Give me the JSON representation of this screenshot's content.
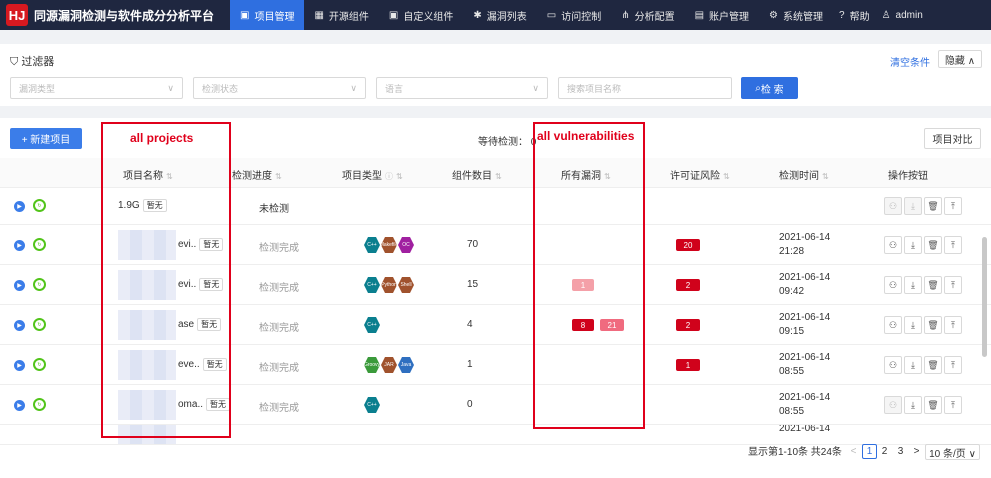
{
  "nav": {
    "logo": "HJ",
    "title": "同源漏洞检测与软件成分分析平台",
    "items": [
      {
        "label": "项目管理",
        "icon": "▣"
      },
      {
        "label": "开源组件",
        "icon": "▦"
      },
      {
        "label": "自定义组件",
        "icon": "▣"
      },
      {
        "label": "漏洞列表",
        "icon": "✱"
      },
      {
        "label": "访问控制",
        "icon": "▭"
      },
      {
        "label": "分析配置",
        "icon": "⋔"
      },
      {
        "label": "账户管理",
        "icon": "▤"
      },
      {
        "label": "系统管理",
        "icon": "⚙"
      },
      {
        "label": "帮助",
        "icon": "?"
      },
      {
        "label": "admin",
        "icon": "♙"
      }
    ]
  },
  "filter": {
    "title": "过滤器",
    "clear": "清空条件",
    "hide": "隐藏 ∧",
    "vuln_type_placeholder": "漏洞类型",
    "status_placeholder": "检测状态",
    "language_placeholder": "语言",
    "search_placeholder": "搜索项目名称",
    "search_button": "检 索"
  },
  "toolbar": {
    "new_project": "+ 新建项目",
    "pending": "等待检测： 0",
    "compare": "项目对比"
  },
  "columns": [
    "项目名称",
    "检测进度",
    "项目类型",
    "组件数目",
    "所有漏洞",
    "许可证风险",
    "检测时间",
    "操作按钮"
  ],
  "rows": [
    {
      "name": "1.9G",
      "tag": "暂无",
      "status": "未检测",
      "types": [],
      "count": "",
      "vulns": [],
      "license": "",
      "date": "",
      "time": ""
    },
    {
      "name": "evi..",
      "tag": "暂无",
      "status": "检测完成",
      "types": [
        {
          "label": "C++",
          "color": "#0b7f8f"
        },
        {
          "label": "Makefile",
          "color": "#a0522d"
        },
        {
          "label": "OC",
          "color": "#a020a0"
        }
      ],
      "count": "70",
      "vulns": [],
      "license": "20",
      "date": "2021-06-14",
      "time": "21:28"
    },
    {
      "name": "evi..",
      "tag": "暂无",
      "status": "检测完成",
      "types": [
        {
          "label": "C++",
          "color": "#0b7f8f"
        },
        {
          "label": "Python",
          "color": "#a0522d"
        },
        {
          "label": "Shell",
          "color": "#a0522d"
        }
      ],
      "count": "15",
      "vulns": [
        {
          "value": "1",
          "color": "#f4a0a8"
        }
      ],
      "license": "2",
      "date": "2021-06-14",
      "time": "09:42"
    },
    {
      "name": "ase",
      "tag": "暂无",
      "status": "检测完成",
      "types": [
        {
          "label": "C++",
          "color": "#0b7f8f"
        }
      ],
      "count": "4",
      "vulns": [
        {
          "value": "8",
          "color": "#d0021b"
        },
        {
          "value": "21",
          "color": "#f06b7f"
        }
      ],
      "license": "2",
      "date": "2021-06-14",
      "time": "09:15"
    },
    {
      "name": "eve..",
      "tag": "暂无",
      "status": "检测完成",
      "types": [
        {
          "label": "Groovy",
          "color": "#3a9a3a"
        },
        {
          "label": "JAR",
          "color": "#a0522d"
        },
        {
          "label": "Java",
          "color": "#2f6fc0"
        }
      ],
      "count": "1",
      "vulns": [],
      "license": "1",
      "date": "2021-06-14",
      "time": "08:55"
    },
    {
      "name": "oma..",
      "tag": "暂无",
      "status": "检测完成",
      "types": [
        {
          "label": "C++",
          "color": "#0b7f8f"
        }
      ],
      "count": "0",
      "vulns": [],
      "license": "",
      "date": "2021-06-14",
      "time": "08:55"
    },
    {
      "name": "",
      "tag": "",
      "status": "",
      "types": [],
      "count": "",
      "vulns": [],
      "license": "",
      "date": "2021-06-14",
      "time": ""
    }
  ],
  "pagination": {
    "summary": "显示第1-10条 共24条",
    "prev": "<",
    "pages": [
      "1",
      "2",
      "3"
    ],
    "next": ">",
    "size": "10 条/页 ∨"
  },
  "annotations": {
    "projects": "all projects",
    "vulns": "all vulnerabilities"
  },
  "colors": {
    "nav_bg": "#1f2740",
    "accent": "#2f6fe0",
    "license_red": "#d0021b",
    "annotation": "#e0001b"
  }
}
